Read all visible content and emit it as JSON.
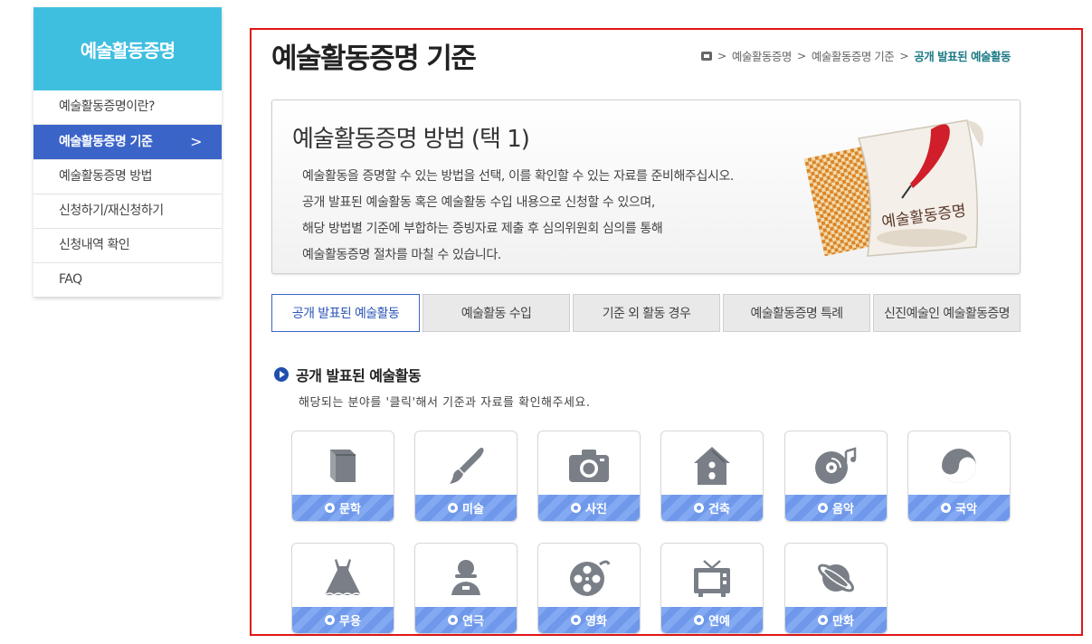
{
  "sidebar": {
    "title": "예술활동증명",
    "items": [
      {
        "label": "예술활동증명이란?"
      },
      {
        "label": "예술활동증명 기준",
        "chevron": ">"
      },
      {
        "label": "예술활동증명 방법"
      },
      {
        "label": "신청하기/재신청하기"
      },
      {
        "label": "신청내역 확인"
      },
      {
        "label": "FAQ"
      }
    ]
  },
  "header": {
    "title": "예술활동증명 기준",
    "breadcrumb": [
      ">",
      "예술활동증명",
      ">",
      "예술활동증명 기준",
      ">",
      "공개 발표된 예술활동"
    ]
  },
  "info": {
    "title": "예술활동증명 방법 (택 1)",
    "lines": [
      "예술활동을 증명할 수 있는 방법을 선택, 이를 확인할 수 있는 자료를 준비해주십시오.",
      "공개 발표된 예술활동 혹은 예술활동 수입 내용으로 신청할 수 있으며,",
      "해당 방법별 기준에 부합하는 증빙자료 제출 후 심의위원회 심의를 통해",
      "예술활동증명 절차를 마칠 수 있습니다."
    ],
    "illustration_text": "예술활동증명"
  },
  "tabs": [
    {
      "label": "공개 발표된 예술활동"
    },
    {
      "label": "예술활동 수입"
    },
    {
      "label": "기준 외 활동 경우"
    },
    {
      "label": "예술활동증명 특례"
    },
    {
      "label": "신진예술인 예술활동증명"
    }
  ],
  "section": {
    "title": "공개 발표된 예술활동",
    "description": "해당되는 분야를 '클릭'해서 기준과 자료를 확인해주세요."
  },
  "categories": [
    {
      "label": "문학",
      "icon": "book-icon"
    },
    {
      "label": "미술",
      "icon": "paintbrush-icon"
    },
    {
      "label": "사진",
      "icon": "camera-icon"
    },
    {
      "label": "건축",
      "icon": "house-icon"
    },
    {
      "label": "음악",
      "icon": "music-disc-icon"
    },
    {
      "label": "국악",
      "icon": "taegeuk-icon"
    },
    {
      "label": "무용",
      "icon": "dress-icon"
    },
    {
      "label": "연극",
      "icon": "actor-icon"
    },
    {
      "label": "영화",
      "icon": "film-reel-icon"
    },
    {
      "label": "연예",
      "icon": "tv-icon"
    },
    {
      "label": "만화",
      "icon": "planet-icon"
    }
  ],
  "colors": {
    "sidebar_head": "#3fbfe0",
    "sidebar_active": "#3b64c8",
    "frame_border": "#e01515",
    "card_label": "#6f98ea",
    "icon_gray": "#7a7f87"
  }
}
